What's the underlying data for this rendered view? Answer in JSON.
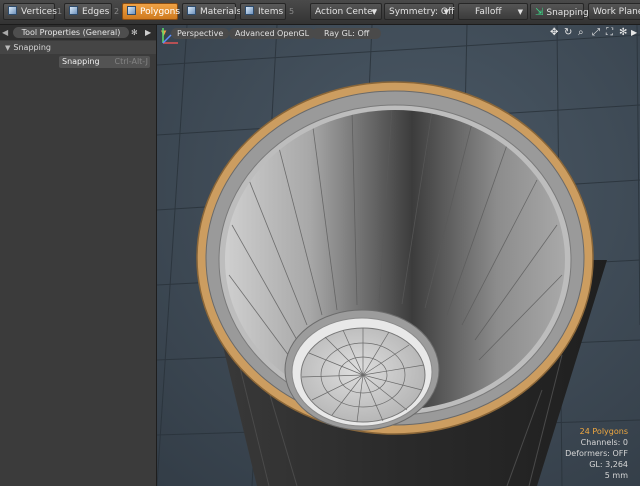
{
  "toolbar": {
    "modes": [
      {
        "label": "Vertices",
        "hotkey": "1",
        "icon": "vertices-cube-icon"
      },
      {
        "label": "Edges",
        "hotkey": "2",
        "icon": "edges-cube-icon"
      },
      {
        "label": "Polygons",
        "hotkey": "3",
        "icon": "polygons-cube-icon",
        "active": true
      },
      {
        "label": "Materials",
        "hotkey": "",
        "icon": "materials-cube-icon"
      },
      {
        "label": "Items",
        "hotkey": "5",
        "icon": "items-cube-icon"
      }
    ],
    "action_center": "Action Center",
    "symmetry": "Symmetry: Off",
    "falloff": "Falloff",
    "snapping": "Snapping",
    "work_plane": "Work Plane"
  },
  "left_panel": {
    "tab_title": "Tool Properties (General)",
    "section_title": "Snapping",
    "snapping_row": {
      "label": "Snapping",
      "shortcut": "Ctrl-Alt-J"
    }
  },
  "viewport": {
    "view_label": "Perspective",
    "render_label": "Advanced OpenGL",
    "raygl_label": "Ray GL: Off",
    "stats": {
      "polygons": "24 Polygons",
      "channels": "Channels: 0",
      "deformers": "Deformers: OFF",
      "gl": "GL: 3,264",
      "scale": "5 mm"
    }
  },
  "colors": {
    "accent_orange": "#f0a245",
    "rim_tan": "#c99a5e",
    "snap_green": "#3ddf8a",
    "viewport_bg": "#3d4a55"
  }
}
